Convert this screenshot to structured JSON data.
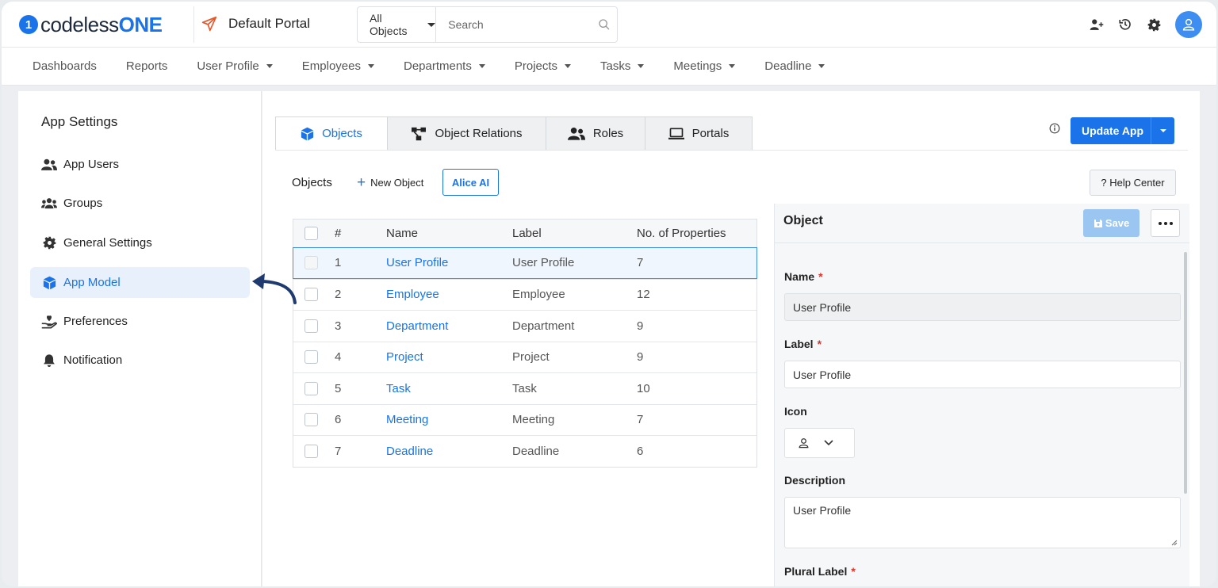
{
  "brand": {
    "mark": "1",
    "prefix": "codeless",
    "suffix": "ONE"
  },
  "portal": {
    "name": "Default Portal"
  },
  "search": {
    "scope": "All Objects",
    "placeholder": "Search"
  },
  "nav": {
    "items": [
      {
        "label": "Dashboards",
        "dropdown": false
      },
      {
        "label": "Reports",
        "dropdown": false
      },
      {
        "label": "User Profile",
        "dropdown": true
      },
      {
        "label": "Employees",
        "dropdown": true
      },
      {
        "label": "Departments",
        "dropdown": true
      },
      {
        "label": "Projects",
        "dropdown": true
      },
      {
        "label": "Tasks",
        "dropdown": true
      },
      {
        "label": "Meetings",
        "dropdown": true
      },
      {
        "label": "Deadline",
        "dropdown": true
      }
    ]
  },
  "sidebar": {
    "title": "App Settings",
    "items": [
      {
        "label": "App Users",
        "icon": "users-icon"
      },
      {
        "label": "Groups",
        "icon": "groups-icon"
      },
      {
        "label": "General Settings",
        "icon": "gear-icon"
      },
      {
        "label": "App Model",
        "icon": "cube-icon",
        "active": true
      },
      {
        "label": "Preferences",
        "icon": "hand-heart-icon"
      },
      {
        "label": "Notification",
        "icon": "bell-icon"
      }
    ]
  },
  "tabs": [
    {
      "label": "Objects",
      "icon": "cube-icon",
      "active": true
    },
    {
      "label": "Object Relations",
      "icon": "relations-icon"
    },
    {
      "label": "Roles",
      "icon": "users-icon"
    },
    {
      "label": "Portals",
      "icon": "laptop-icon"
    }
  ],
  "toolbar": {
    "update_label": "Update App",
    "objects_title": "Objects",
    "new_object": "New Object",
    "alice_ai": "Alice AI",
    "help_center": "? Help Center"
  },
  "table": {
    "headers": {
      "num": "#",
      "name": "Name",
      "label": "Label",
      "props": "No. of Properties"
    },
    "rows": [
      {
        "num": "1",
        "name": "User Profile",
        "label": "User Profile",
        "props": "7"
      },
      {
        "num": "2",
        "name": "Employee",
        "label": "Employee",
        "props": "12"
      },
      {
        "num": "3",
        "name": "Department",
        "label": "Department",
        "props": "9"
      },
      {
        "num": "4",
        "name": "Project",
        "label": "Project",
        "props": "9"
      },
      {
        "num": "5",
        "name": "Task",
        "label": "Task",
        "props": "10"
      },
      {
        "num": "6",
        "name": "Meeting",
        "label": "Meeting",
        "props": "7"
      },
      {
        "num": "7",
        "name": "Deadline",
        "label": "Deadline",
        "props": "6"
      }
    ]
  },
  "panel": {
    "title": "Object",
    "save_label": "Save",
    "name_label": "Name",
    "name_value": "User Profile",
    "label_label": "Label",
    "label_value": "User Profile",
    "icon_label": "Icon",
    "description_label": "Description",
    "description_value": "User Profile",
    "plural_label": "Plural Label",
    "required_mark": "*"
  },
  "colors": {
    "accent": "#1a73e8",
    "save_disabled": "#9cc6f2",
    "required": "#d9342b"
  }
}
